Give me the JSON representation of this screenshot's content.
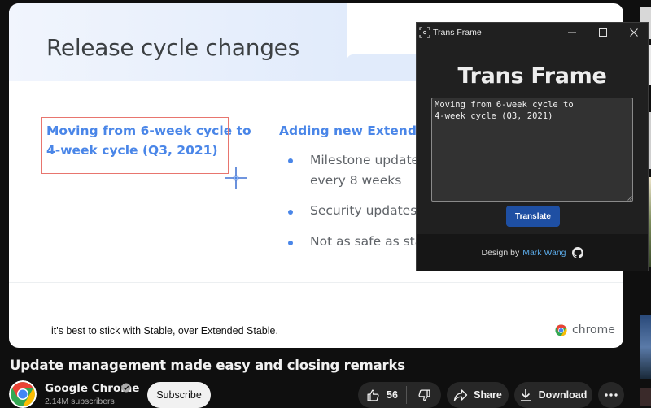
{
  "slide": {
    "title": "Release cycle changes",
    "left_heading": "Moving from 6-week cycle to\n4-week cycle (Q3, 2021)",
    "right_heading": "Adding new Extended",
    "bullets": [
      {
        "text": "Milestone updates\nevery 8 weeks"
      },
      {
        "text": "Security updates e"
      },
      {
        "text": "Not as safe as stab"
      }
    ],
    "caption": "it's best to stick with Stable, over Extended Stable.",
    "brand": "chrome"
  },
  "video": {
    "title": "Update management made easy and closing remarks",
    "channel_name": "Google Chrome",
    "subscribers": "2.14M subscribers",
    "subscribe_label": "Subscribe",
    "likes": "56",
    "share_label": "Share",
    "download_label": "Download"
  },
  "trans_frame": {
    "window_title": "Trans Frame",
    "heading": "Trans Frame",
    "text_value": "Moving from 6-week cycle to\n4-week cycle (Q3, 2021)",
    "translate_label": "Translate",
    "footer_prefix": "Design by",
    "footer_author": "Mark Wang"
  },
  "colors": {
    "accent_blue": "#4a86e8",
    "translate_button": "#1e4fa3",
    "selection_border": "#e8756e",
    "link": "#5aa9e6"
  },
  "icons": {
    "crosshair": "crosshair-icon",
    "chrome_logo": "chrome-logo-icon",
    "verified": "verified-check-icon",
    "like": "thumbs-up-icon",
    "dislike": "thumbs-down-icon",
    "share": "share-arrow-icon",
    "download": "download-icon",
    "more": "more-dots-icon",
    "github": "github-icon"
  }
}
